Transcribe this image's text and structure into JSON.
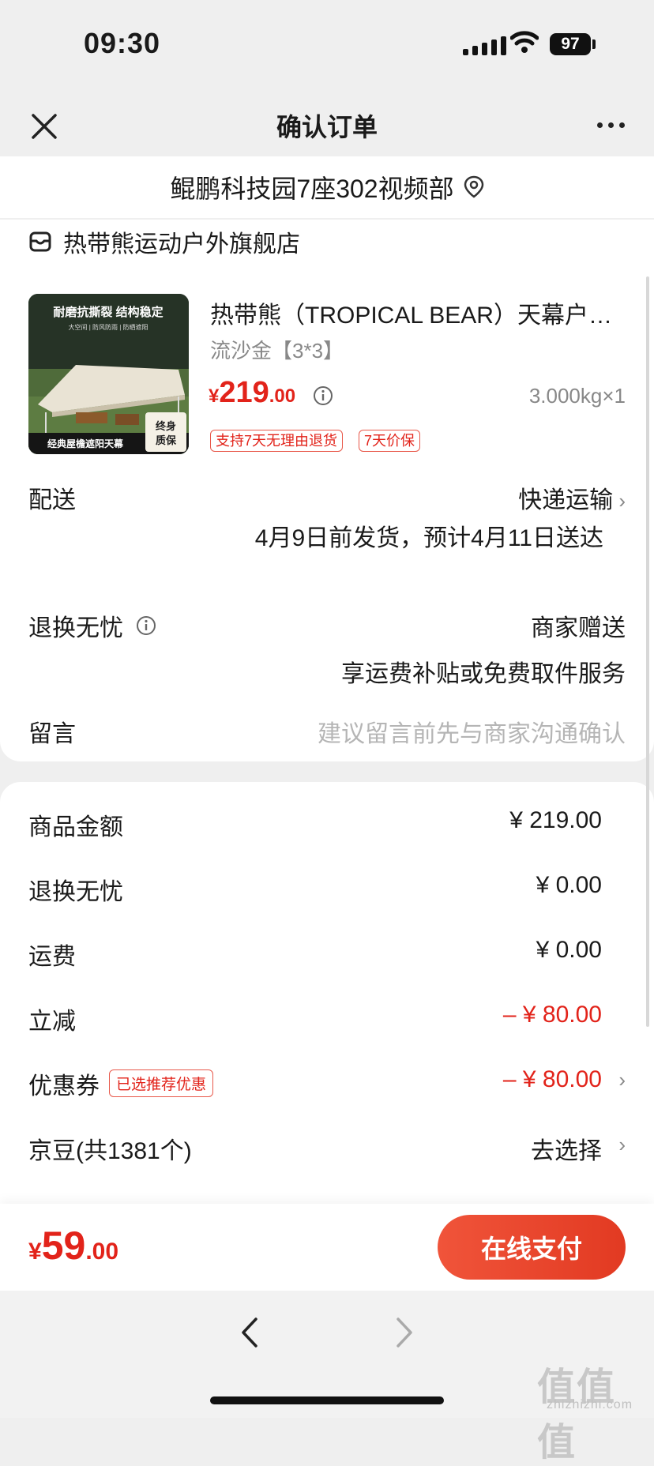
{
  "status_bar": {
    "time": "09:30",
    "battery": "97"
  },
  "header": {
    "title": "确认订单"
  },
  "address": {
    "text": "鲲鹏科技园7座302视频部"
  },
  "store": {
    "name": "热带熊运动户外旗舰店"
  },
  "product": {
    "title": "热带熊（TROPICAL BEAR）天幕户外...",
    "variant": "流沙金【3*3】",
    "price_currency": "¥",
    "price_int": "219",
    "price_dec": ".00",
    "weight_qty": "3.000kg×1",
    "tags": [
      "支持7天无理由退货",
      "7天价保"
    ],
    "image_text": {
      "top": "耐磨抗撕裂 结构稳定",
      "sub": "大空间 | 防风防雨 | 防晒遮阳",
      "bottom": "经典屋檐遮阳天幕",
      "badge_line1": "终身",
      "badge_line2": "质保"
    }
  },
  "delivery": {
    "label": "配送",
    "method": "快递运输",
    "eta": "4月9日前发货，预计4月11日送达"
  },
  "return_service": {
    "label": "退换无忧",
    "value": "商家赠送",
    "desc": "享运费补贴或免费取件服务"
  },
  "message": {
    "label": "留言",
    "placeholder": "建议留言前先与商家沟通确认"
  },
  "summary": [
    {
      "label": "商品金额",
      "value": "¥ 219.00"
    },
    {
      "label": "退换无忧",
      "value": "¥ 0.00"
    },
    {
      "label": "运费",
      "value": "¥ 0.00"
    },
    {
      "label": "立减",
      "value": "– ¥ 80.00"
    },
    {
      "label": "优惠券",
      "value": "– ¥ 80.00",
      "badge": "已选推荐优惠"
    },
    {
      "label": "京豆(共1381个)",
      "value": "去选择"
    }
  ],
  "bottom": {
    "currency": "¥",
    "total_int": "59",
    "total_dec": ".00",
    "pay_label": "在线支付"
  },
  "watermark": {
    "text": "值值值",
    "sub": "zhizhizhi.com"
  },
  "colors": {
    "accent": "#e2231a",
    "button": "#e8452c"
  }
}
